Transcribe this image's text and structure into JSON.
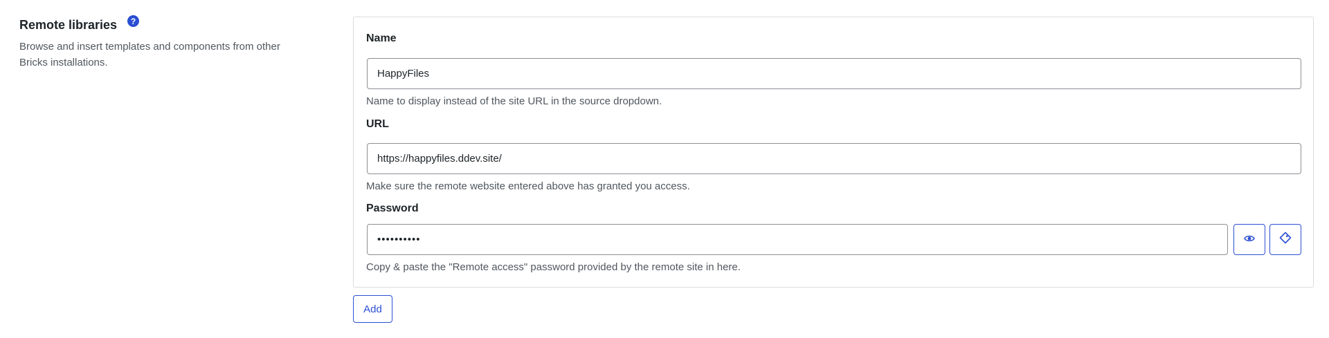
{
  "section": {
    "title": "Remote libraries",
    "help_icon": "?",
    "description": "Browse and insert templates and components from other Bricks installations."
  },
  "form": {
    "name": {
      "label": "Name",
      "value": "HappyFiles",
      "help": "Name to display instead of the site URL in the source dropdown."
    },
    "url": {
      "label": "URL",
      "value": "https://happyfiles.ddev.site/",
      "help": "Make sure the remote website entered above has granted you access."
    },
    "password": {
      "label": "Password",
      "masked_value": "••••••••••",
      "help": "Copy & paste the \"Remote access\" password provided by the remote site in here.",
      "toggle_visibility_icon": "eye-icon",
      "generate_icon": "tag-icon"
    }
  },
  "actions": {
    "add_label": "Add"
  },
  "colors": {
    "accent": "#2b4fd3",
    "border": "#dcdcde",
    "input_border": "#8c8f94",
    "muted_text": "#50575e"
  }
}
